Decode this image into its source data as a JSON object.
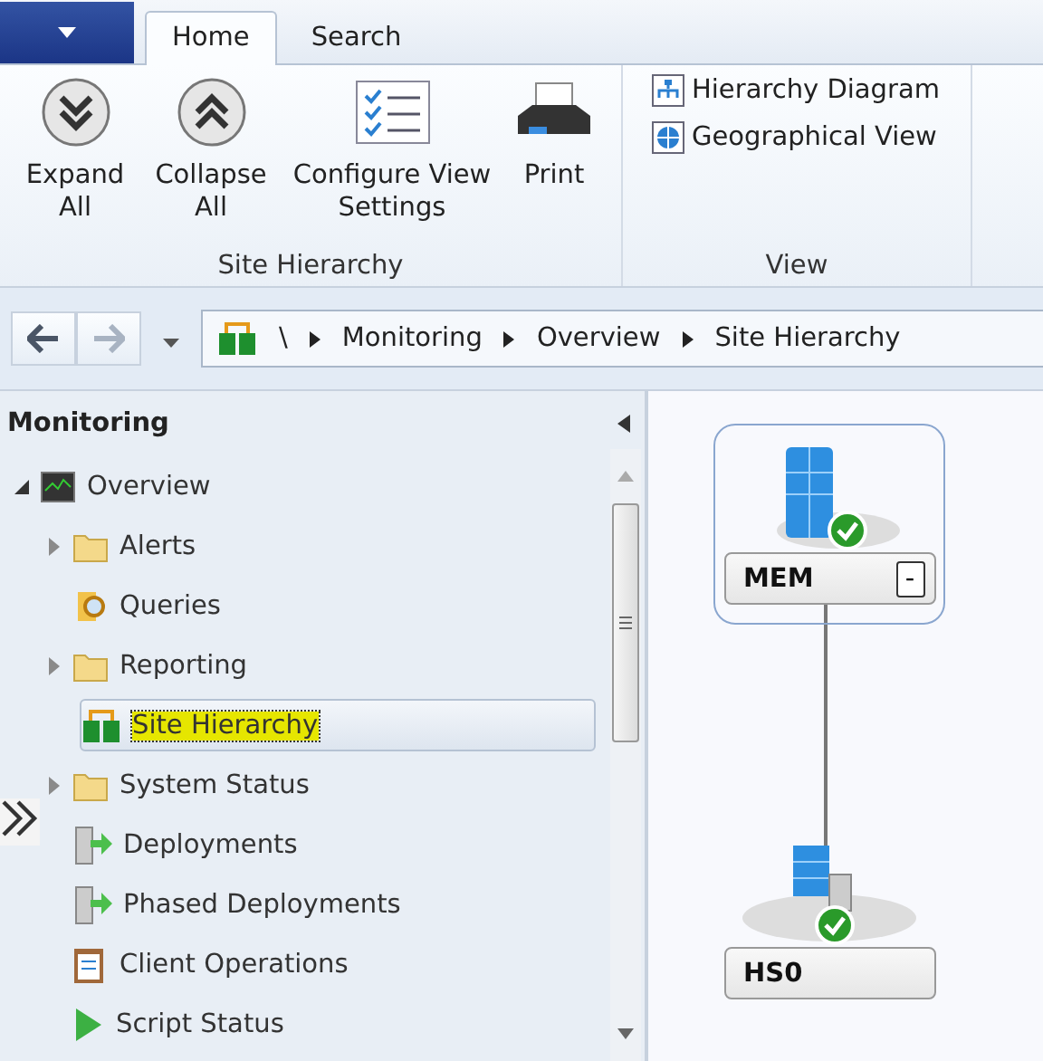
{
  "ribbon": {
    "tabs": [
      {
        "label": "Home",
        "selected": true
      },
      {
        "label": "Search",
        "selected": false
      }
    ],
    "groups": [
      {
        "label": "Site Hierarchy",
        "buttons": [
          {
            "kind": "expand",
            "label": "Expand All"
          },
          {
            "kind": "collapse",
            "label": "Collapse All"
          },
          {
            "kind": "settings",
            "label": "Configure View Settings"
          },
          {
            "kind": "print",
            "label": "Print"
          }
        ]
      },
      {
        "label": "View",
        "buttons": [
          {
            "kind": "hierarchy",
            "label": "Hierarchy Diagram"
          },
          {
            "kind": "globe",
            "label": "Geographical View"
          }
        ]
      }
    ]
  },
  "breadcrumb": [
    "\\",
    "Monitoring",
    "Overview",
    "Site Hierarchy"
  ],
  "navigation_pane": {
    "title": "Monitoring",
    "tree": [
      {
        "label": "Overview",
        "kind": "overview",
        "expanded": true,
        "selected": false,
        "children": [
          {
            "label": "Alerts",
            "kind": "folder",
            "expanded": false,
            "selected": false
          },
          {
            "label": "Queries",
            "kind": "queries",
            "selected": false
          },
          {
            "label": "Reporting",
            "kind": "folder",
            "expanded": false,
            "selected": false
          },
          {
            "label": "Site Hierarchy",
            "kind": "hierarchy",
            "selected": true
          },
          {
            "label": "System Status",
            "kind": "folder",
            "expanded": false,
            "selected": false
          },
          {
            "label": "Deployments",
            "kind": "deployment",
            "selected": false
          },
          {
            "label": "Phased Deployments",
            "kind": "deployment",
            "selected": false
          },
          {
            "label": "Client Operations",
            "kind": "clipboard",
            "selected": false
          },
          {
            "label": "Script Status",
            "kind": "play",
            "selected": false
          }
        ]
      }
    ]
  },
  "diagram": {
    "nodes": [
      {
        "label": "MEM",
        "kind": "cas",
        "selected": true,
        "toggle": "-"
      },
      {
        "label": "HS0",
        "kind": "primary",
        "selected": false
      }
    ]
  }
}
